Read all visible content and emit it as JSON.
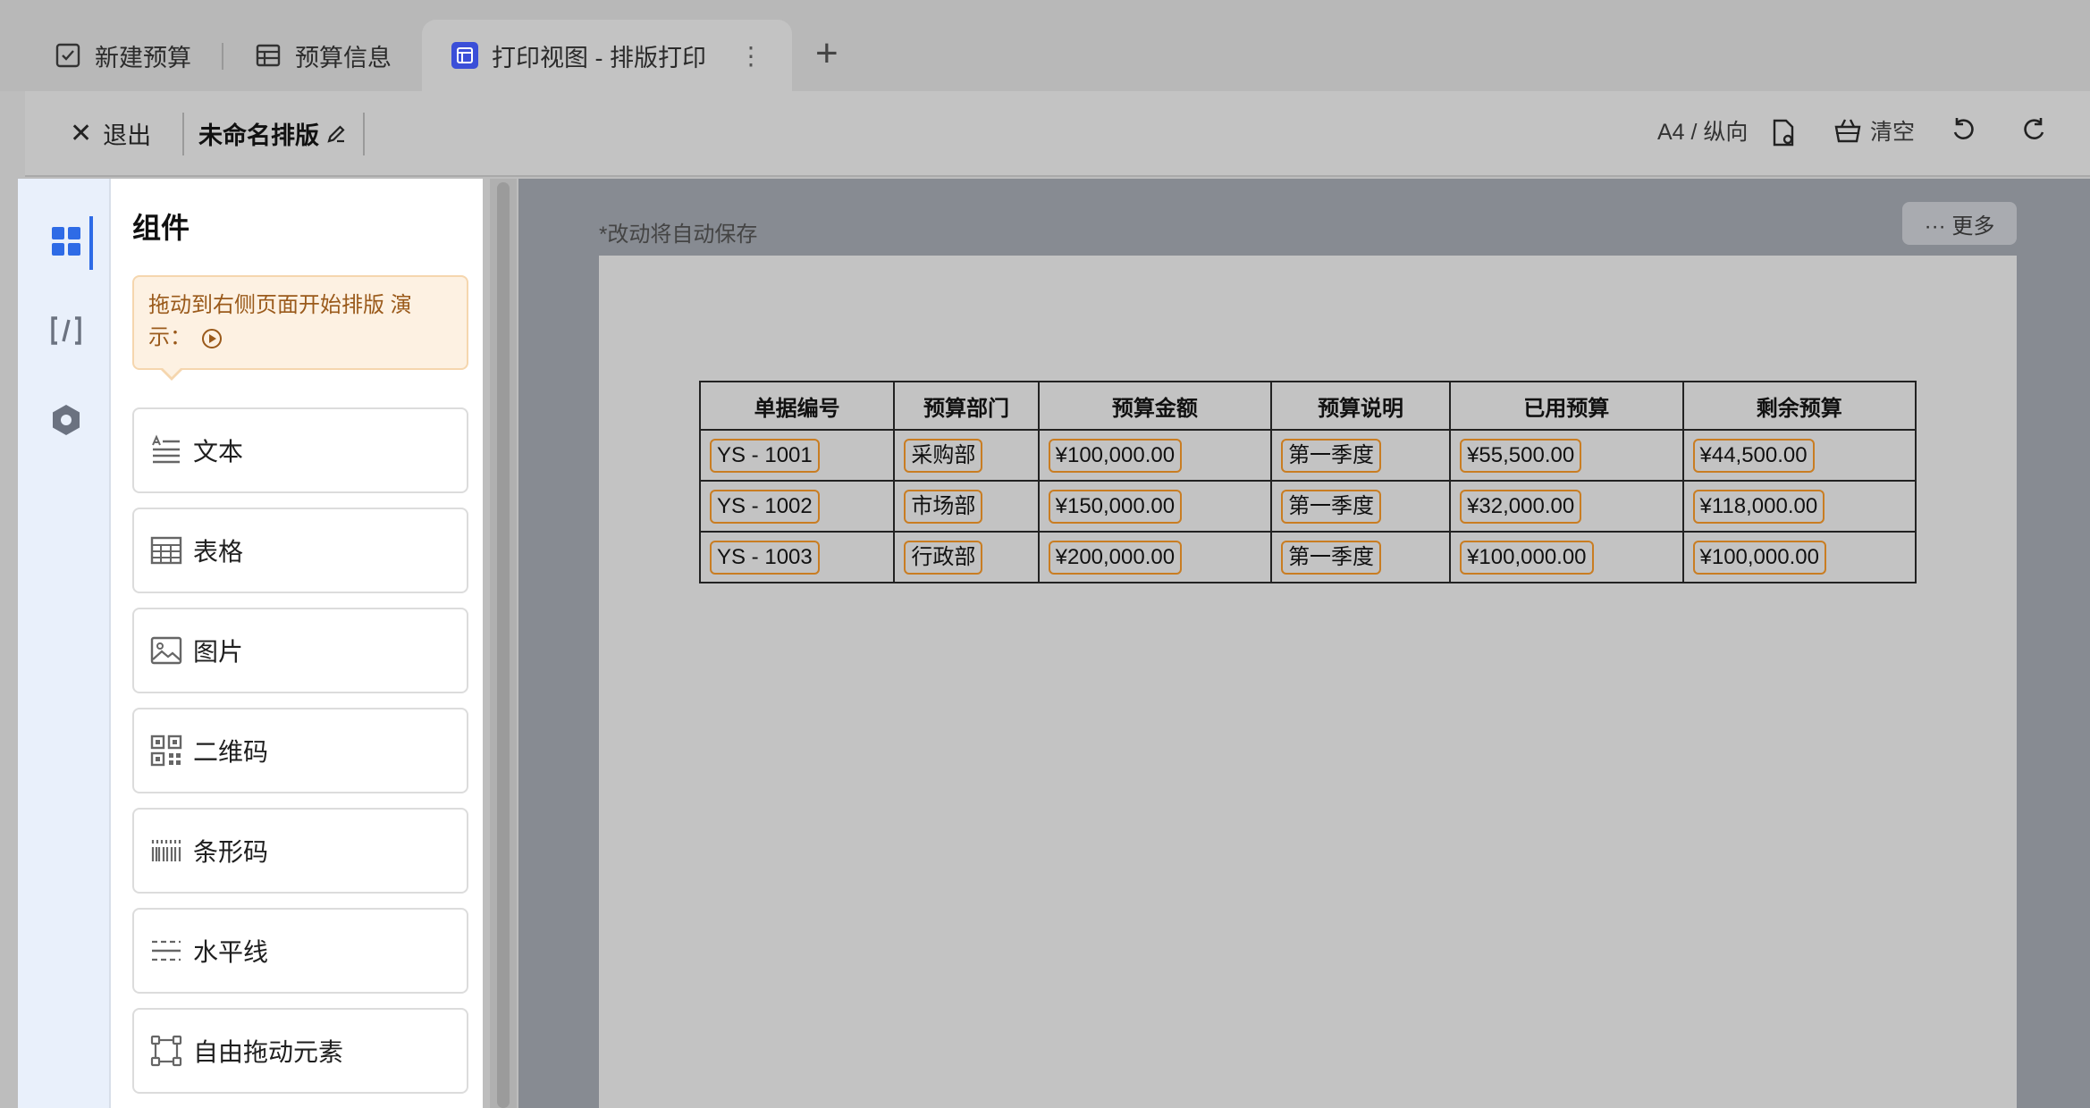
{
  "tabs": [
    {
      "label": "新建预算",
      "icon": "checkbox-icon"
    },
    {
      "label": "预算信息",
      "icon": "table-icon"
    },
    {
      "label": "打印视图 - 排版打印",
      "icon": "layout-icon",
      "active": true
    }
  ],
  "toolbar": {
    "exit_label": "退出",
    "doc_title": "未命名排版",
    "paper_setting": "A4 / 纵向",
    "clear_label": "清空"
  },
  "panel": {
    "title": "组件",
    "tip_text": "拖动到右侧页面开始排版 演示：",
    "components": [
      {
        "label": "文本",
        "icon": "text-icon"
      },
      {
        "label": "表格",
        "icon": "table-icon"
      },
      {
        "label": "图片",
        "icon": "image-icon"
      },
      {
        "label": "二维码",
        "icon": "qrcode-icon"
      },
      {
        "label": "条形码",
        "icon": "barcode-icon"
      },
      {
        "label": "水平线",
        "icon": "horizontal-line-icon"
      },
      {
        "label": "自由拖动元素",
        "icon": "free-drag-icon"
      }
    ]
  },
  "canvas": {
    "autosave_text": "*改动将自动保存",
    "more_label": "··· 更多"
  },
  "table": {
    "headers": [
      "单据编号",
      "预算部门",
      "预算金额",
      "预算说明",
      "已用预算",
      "剩余预算"
    ],
    "rows": [
      [
        "YS - 1001",
        "采购部",
        "¥100,000.00",
        "第一季度",
        "¥55,500.00",
        "¥44,500.00"
      ],
      [
        "YS - 1002",
        "市场部",
        "¥150,000.00",
        "第一季度",
        "¥32,000.00",
        "¥118,000.00"
      ],
      [
        "YS - 1003",
        "行政部",
        "¥200,000.00",
        "第一季度",
        "¥100,000.00",
        "¥100,000.00"
      ]
    ]
  },
  "colors": {
    "accent": "#2e6be6",
    "cell_highlight": "#c97d22",
    "tip_text": "#9a5a1b"
  }
}
